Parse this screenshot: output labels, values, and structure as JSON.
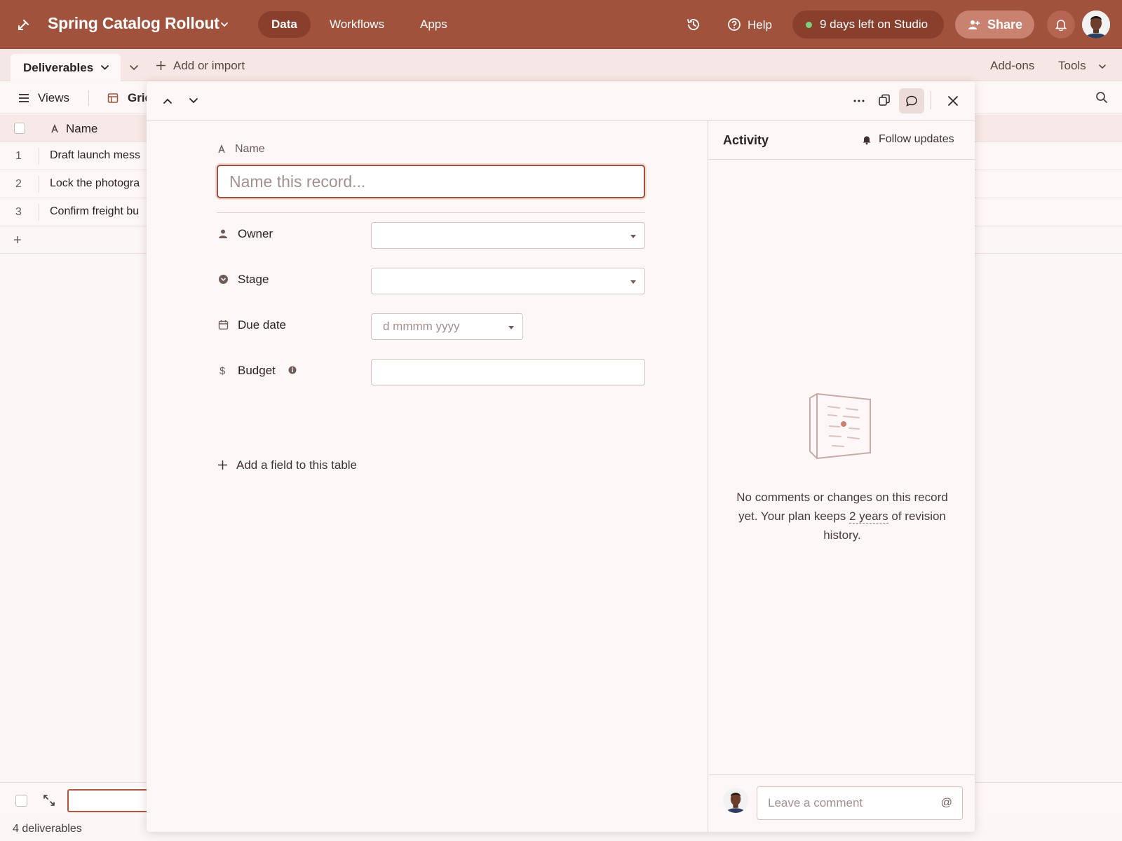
{
  "app": {
    "title": "Spring Catalog Rollout",
    "nav_tabs": [
      {
        "label": "Data",
        "active": true
      },
      {
        "label": "Workflows",
        "active": false
      },
      {
        "label": "Apps",
        "active": false
      }
    ],
    "help_label": "Help",
    "trial_label": "9 days left on Studio",
    "share_label": "Share",
    "colors": {
      "brand": "#a0523d",
      "brand_dark": "#8a3f2d",
      "accent_border": "#a0523d",
      "trial_dot": "#7bd07f"
    }
  },
  "tablebar": {
    "active_table": "Deliverables",
    "add_import_label": "Add or import",
    "addons_label": "Add-ons",
    "tools_label": "Tools"
  },
  "viewbar": {
    "views_label": "Views",
    "current_view": "Grid"
  },
  "grid": {
    "column_header": "Name",
    "rows": [
      {
        "num": "1",
        "name": "Draft launch mess"
      },
      {
        "num": "2",
        "name": "Lock the photogra"
      },
      {
        "num": "3",
        "name": "Confirm freight bu"
      }
    ],
    "add_row_label": "+",
    "record_count": "4 deliverables"
  },
  "record": {
    "name_label": "Name",
    "name_placeholder": "Name this record...",
    "name_value": "",
    "fields": [
      {
        "label": "Owner",
        "type": "select",
        "value": "",
        "icon": "person-icon"
      },
      {
        "label": "Stage",
        "type": "select",
        "value": "",
        "icon": "stage-icon"
      },
      {
        "label": "Due date",
        "type": "date",
        "placeholder": "d mmmm yyyy",
        "icon": "calendar-icon"
      },
      {
        "label": "Budget",
        "type": "currency",
        "value": "",
        "icon": "dollar-icon"
      }
    ],
    "add_field_label": "Add a field to this table"
  },
  "activity": {
    "title": "Activity",
    "follow_label": "Follow updates",
    "empty_part1": "No comments or changes on this record yet. Your plan keeps ",
    "empty_link": "2 years",
    "empty_part2": " of revision history.",
    "comment_placeholder": "Leave a comment",
    "mention_symbol": "@"
  }
}
